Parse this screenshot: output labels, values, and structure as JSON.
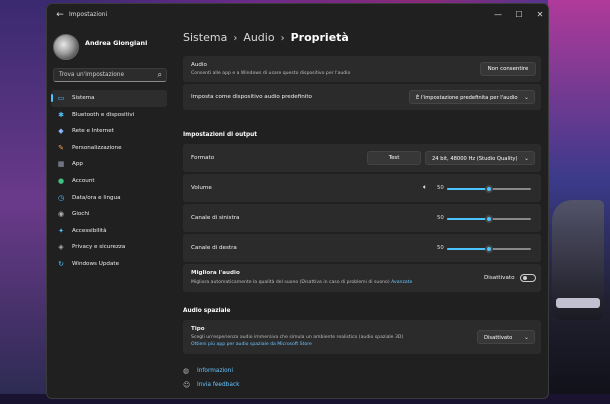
{
  "window": {
    "title": "Impostazioni",
    "back_glyph": "←",
    "minimize_glyph": "—",
    "maximize_glyph": "☐",
    "close_glyph": "✕"
  },
  "user": {
    "name": "Andrea Giongiani"
  },
  "search": {
    "placeholder": "Trova un'impostazione",
    "icon": "search-icon",
    "glyph": "⌕"
  },
  "sidebar": {
    "items": [
      {
        "label": "Sistema",
        "icon": "monitor-icon",
        "glyph": "▭",
        "color": "#4cc2ff",
        "active": true
      },
      {
        "label": "Bluetooth e dispositivi",
        "icon": "bluetooth-icon",
        "glyph": "✱",
        "color": "#4cc2ff"
      },
      {
        "label": "Rete e Internet",
        "icon": "wifi-icon",
        "glyph": "◆",
        "color": "#8ab4f8"
      },
      {
        "label": "Personalizzazione",
        "icon": "brush-icon",
        "glyph": "✎",
        "color": "#f0a050"
      },
      {
        "label": "App",
        "icon": "apps-icon",
        "glyph": "▦",
        "color": "#9aa0b8"
      },
      {
        "label": "Account",
        "icon": "person-icon",
        "glyph": "●",
        "color": "#40c080"
      },
      {
        "label": "Data/ora e lingua",
        "icon": "clock-globe-icon",
        "glyph": "◷",
        "color": "#4cc2ff"
      },
      {
        "label": "Giochi",
        "icon": "gamepad-icon",
        "glyph": "◉",
        "color": "#b0b0b0"
      },
      {
        "label": "Accessibilità",
        "icon": "accessibility-icon",
        "glyph": "✦",
        "color": "#4cc2ff"
      },
      {
        "label": "Privacy e sicurezza",
        "icon": "shield-icon",
        "glyph": "◈",
        "color": "#b0b0b0"
      },
      {
        "label": "Windows Update",
        "icon": "update-icon",
        "glyph": "↻",
        "color": "#4cc2ff"
      }
    ]
  },
  "breadcrumb": {
    "part1": "Sistema",
    "sep": "›",
    "part2": "Audio",
    "current": "Proprietà"
  },
  "audio_permission": {
    "label": "Audio",
    "desc": "Consenti alle app e a Windows di usare questo dispositivo per l'audio",
    "button": "Non consentire"
  },
  "default_device": {
    "label": "Imposta come dispositivo audio predefinito",
    "value": "È l'impostazione predefinita per l'audio"
  },
  "output": {
    "section": "Impostazioni di output",
    "format_label": "Formato",
    "test_button": "Test",
    "format_value": "24 bit, 48000 Hz (Studio Quality)",
    "volume_label": "Volume",
    "volume_value": "50",
    "volume_level": 0.5,
    "left_label": "Canale di sinistra",
    "left_value": "50",
    "left_level": 0.5,
    "right_label": "Canale di destra",
    "right_value": "50",
    "right_level": 0.5
  },
  "enhance": {
    "label": "Migliora l'audio",
    "desc": "Migliora automaticamente la qualità del suono (Disattiva in caso di problemi di suono)",
    "link": "Avanzate",
    "state": "Disattivato"
  },
  "spatial": {
    "section": "Audio spaziale",
    "type_label": "Tipo",
    "type_desc": "Scegli un'esperienza audio immersiva che simula un ambiente realistico (audio spaziale 3D)",
    "type_link": "Ottieni più app per audio spaziale da Microsoft Store",
    "type_value": "Disattivato"
  },
  "footer": {
    "info": "Informazioni",
    "feedback": "Invia feedback"
  },
  "colors": {
    "accent": "#4cc2ff",
    "bg": "#202020",
    "card": "#2b2b2b"
  }
}
